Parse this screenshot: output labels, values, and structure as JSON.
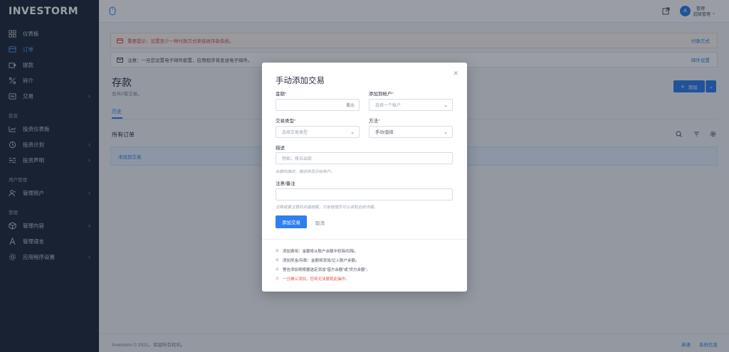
{
  "brand": "INVESTORM",
  "sidebar": {
    "items": [
      {
        "label": "仪表板",
        "icon": "dashboard-icon"
      },
      {
        "label": "订单",
        "icon": "orders-icon",
        "active": true
      },
      {
        "label": "提款",
        "icon": "withdraw-icon"
      },
      {
        "label": "转介",
        "icon": "referral-icon"
      },
      {
        "label": "交易",
        "icon": "transactions-icon",
        "has_children": true
      }
    ],
    "section_invest": "投资",
    "invest_items": [
      {
        "label": "投资仪表板",
        "icon": "invest-dashboard-icon"
      },
      {
        "label": "投资计划",
        "icon": "plan-icon",
        "has_children": true
      },
      {
        "label": "投资声明",
        "icon": "statement-icon",
        "has_children": true
      }
    ],
    "section_users": "用户管理",
    "user_items": [
      {
        "label": "管理用户",
        "icon": "users-icon",
        "has_children": true
      }
    ],
    "section_manage": "管理",
    "manage_items": [
      {
        "label": "管理内容",
        "icon": "content-icon",
        "has_children": true
      },
      {
        "label": "管理语言",
        "icon": "language-icon"
      },
      {
        "label": "应用程序设置",
        "icon": "settings-icon",
        "has_children": true
      }
    ]
  },
  "topbar": {
    "avatar_initial": "A",
    "user_name": "管理",
    "user_role": "超级管理"
  },
  "alerts": {
    "warning_text": "重要提示：设置至少一种付款方式来接收存款系统。",
    "warning_link": "付款方式",
    "note_text": "注意：一旦您设置电子邮件配置，应用程序将发送电子邮件。",
    "note_link": "邮件设置"
  },
  "page": {
    "title": "存款",
    "subtitle": "总共0笔交易。",
    "add_label": "添加",
    "tab_history": "历史",
    "orders_title": "所有订单",
    "empty_text": "未找到交易"
  },
  "footer": {
    "copyright": "Investorm © 2021。保留所有权利。",
    "language": "英语",
    "system_status": "系统信息"
  },
  "modal": {
    "title": "手动添加交易",
    "amount_label": "金额",
    "amount_suffix": "美元",
    "account_label": "添加到帐户",
    "account_placeholder": "选择一个帐户",
    "type_label": "交易类型",
    "type_placeholder": "选择交易类型",
    "method_label": "方法",
    "method_value": "手动/直接",
    "desc_label": "描述",
    "desc_placeholder": "例如，按日出款",
    "desc_hint": "余额的描述，描述将显示给用户。",
    "note_label": "注意/备注",
    "note_hint": "注释或要注意的关键提醒，只有管理员可以读取全部详细。",
    "submit_label": "添加交易",
    "cancel_label": "取消",
    "info": [
      "添加费用：金额将从账户余额中扣除/扣除。",
      "添加奖金/存款：金额将添加/记入账户余额。",
      "警告添加将根据选定添加“借方余额”或“贷方余额”。"
    ],
    "danger": "一旦确认添加，您将无法撤销此操作。"
  },
  "colors": {
    "accent": "#2e7ff0",
    "sidebar_bg": "#1f2a3d",
    "danger": "#e55353"
  }
}
